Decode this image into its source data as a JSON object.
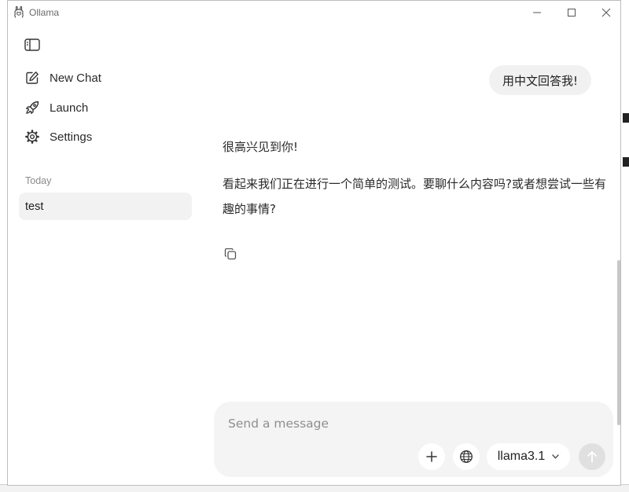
{
  "window": {
    "title": "Ollama"
  },
  "sidebar": {
    "items": [
      {
        "label": "New Chat",
        "icon": "new-chat-icon"
      },
      {
        "label": "Launch",
        "icon": "rocket-icon"
      },
      {
        "label": "Settings",
        "icon": "gear-icon"
      }
    ],
    "section_label": "Today",
    "chats": [
      {
        "title": "test"
      }
    ]
  },
  "conversation": {
    "user_message": "用中文回答我!",
    "assistant_paragraphs": [
      "很高兴见到你!",
      "看起来我们正在进行一个简单的测试。要聊什么内容吗?或者想尝试一些有趣的事情?"
    ]
  },
  "composer": {
    "placeholder": "Send a message",
    "value": "",
    "model": "llama3.1"
  },
  "colors": {
    "bubble_bg": "#f1f1f1",
    "composer_bg": "#f4f4f4",
    "selected_chat_bg": "#f2f2f2",
    "send_disabled_bg": "#e0e0e0"
  }
}
